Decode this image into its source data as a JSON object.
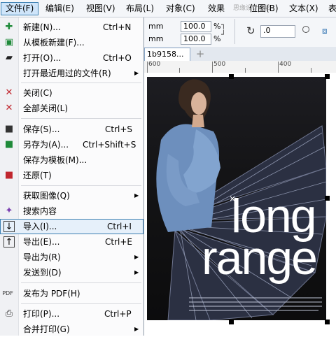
{
  "menubar": {
    "items": [
      "文件(F)",
      "编辑(E)",
      "视图(V)",
      "布局(L)",
      "对象(C)",
      "效果",
      "位图(B)",
      "文本(X)",
      "表"
    ],
    "watermark": "思缘设计论坛"
  },
  "propbar": {
    "unit1": "mm",
    "unit2": "mm",
    "scale_x": "100.0",
    "scale_y": "100.0",
    "percent": "%",
    "angle": ".0"
  },
  "tabs": {
    "doc": "1b9158...",
    "add": "+"
  },
  "ruler": {
    "labels": [
      "600",
      "500",
      "400"
    ]
  },
  "canvas": {
    "headline_1": "long",
    "headline_2": "range"
  },
  "menu": {
    "items": [
      {
        "icon": "new-doc-icon",
        "glyph": "✚",
        "label": "新建(N)...",
        "shortcut": "Ctrl+N"
      },
      {
        "icon": "template-icon",
        "glyph": "▣",
        "label": "从模板新建(F)...",
        "shortcut": ""
      },
      {
        "icon": "open-folder-icon",
        "glyph": "▰",
        "label": "打开(O)...",
        "shortcut": "Ctrl+O"
      },
      {
        "icon": "",
        "glyph": "",
        "label": "打开最近用过的文件(R)",
        "shortcut": "",
        "submenu": true
      },
      {
        "icon": "close-doc-icon",
        "glyph": "✕",
        "label": "关闭(C)",
        "shortcut": ""
      },
      {
        "icon": "close-all-icon",
        "glyph": "✕",
        "label": "全部关闭(L)",
        "shortcut": ""
      },
      {
        "icon": "save-icon",
        "glyph": "■",
        "label": "保存(S)...",
        "shortcut": "Ctrl+S"
      },
      {
        "icon": "save-as-icon",
        "glyph": "■",
        "label": "另存为(A)...",
        "shortcut": "Ctrl+Shift+S"
      },
      {
        "icon": "",
        "glyph": "",
        "label": "保存为模板(M)...",
        "shortcut": ""
      },
      {
        "icon": "revert-icon",
        "glyph": "■",
        "label": "还原(T)",
        "shortcut": ""
      },
      {
        "icon": "",
        "glyph": "",
        "label": "获取图像(Q)",
        "shortcut": "",
        "submenu": true
      },
      {
        "icon": "search-content-icon",
        "glyph": "✦",
        "label": "搜索内容",
        "shortcut": ""
      },
      {
        "icon": "import-icon",
        "glyph": "↓",
        "label": "导入(I)...",
        "shortcut": "Ctrl+I",
        "highlight": true
      },
      {
        "icon": "export-icon",
        "glyph": "↑",
        "label": "导出(E)...",
        "shortcut": "Ctrl+E"
      },
      {
        "icon": "",
        "glyph": "",
        "label": "导出为(R)",
        "shortcut": "",
        "submenu": true
      },
      {
        "icon": "",
        "glyph": "",
        "label": "发送到(D)",
        "shortcut": "",
        "submenu": true
      },
      {
        "icon": "pdf-icon",
        "glyph": "PDF",
        "label": "发布为 PDF(H)",
        "shortcut": ""
      },
      {
        "icon": "print-icon",
        "glyph": "⎙",
        "label": "打印(P)...",
        "shortcut": "Ctrl+P"
      },
      {
        "icon": "",
        "glyph": "",
        "label": "合并打印(G)",
        "shortcut": "",
        "submenu": true
      }
    ]
  }
}
